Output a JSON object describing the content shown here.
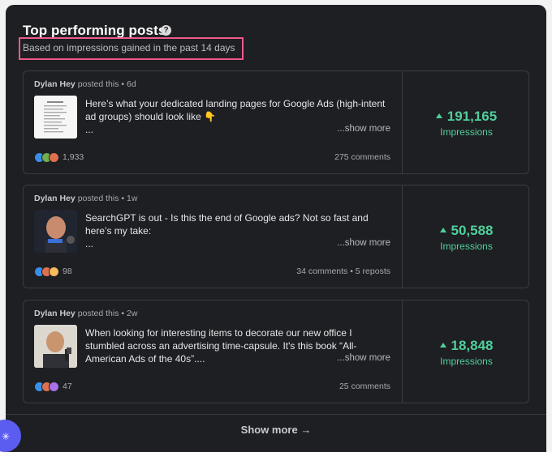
{
  "header": {
    "title": "Top performing posts",
    "help_icon": "?",
    "subtitle": "Based on impressions gained in the past 14 days"
  },
  "posts": [
    {
      "author": "Dylan Hey",
      "posted": " posted this • 6d",
      "text": "Here’s what your dedicated landing pages for Google Ads (high-intent ad groups) should look like 👇",
      "ellipsis": "...",
      "show_more": "...show more",
      "reaction_count": "1,933",
      "engagement": "275 comments",
      "impressions": "191,165",
      "impressions_label": "Impressions"
    },
    {
      "author": "Dylan Hey",
      "posted": " posted this • 1w",
      "text": "SearchGPT is out - Is this the end of Google ads? Not so fast and here’s my take:",
      "ellipsis": "...",
      "show_more": "...show more",
      "reaction_count": "98",
      "engagement": "34 comments • 5 reposts",
      "impressions": "50,588",
      "impressions_label": "Impressions"
    },
    {
      "author": "Dylan Hey",
      "posted": " posted this • 2w",
      "text": "When looking for interesting items to decorate our new office I stumbled across an advertising time-capsule. It's this book “All-American Ads of the 40s”....",
      "ellipsis": "",
      "show_more": "...show more",
      "reaction_count": "47",
      "engagement": "25 comments",
      "impressions": "18,848",
      "impressions_label": "Impressions"
    }
  ],
  "footer": {
    "show_more": "Show more →"
  },
  "colors": {
    "panel_bg": "#1e1f23",
    "accent_green": "#4fcf9a",
    "highlight_pink": "#ef5a8a",
    "like_blue": "#378fe9",
    "celebrate_green": "#6dae4f",
    "love_red": "#df704d",
    "support_purple": "#a872e8",
    "insight_yellow": "#f5bb5c"
  }
}
